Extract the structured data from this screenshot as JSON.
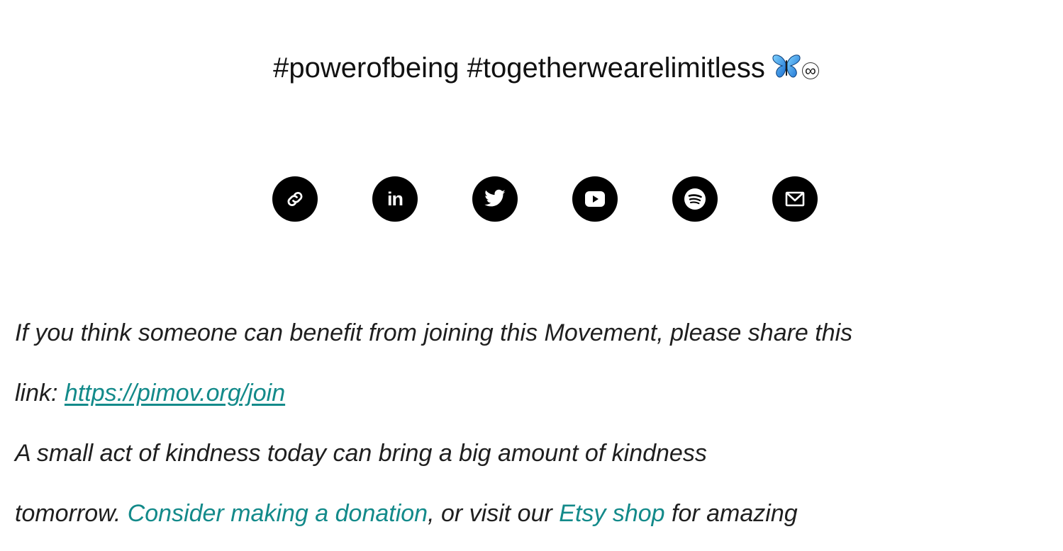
{
  "hashtags": {
    "text": "#powerofbeing #togetherwearelimitless",
    "emoji_icon": "butterfly-icon",
    "infinity_symbol": "∞"
  },
  "social_links": [
    {
      "name": "link",
      "icon": "link-icon"
    },
    {
      "name": "linkedin",
      "icon": "linkedin-icon",
      "text": "in"
    },
    {
      "name": "twitter",
      "icon": "twitter-icon"
    },
    {
      "name": "youtube",
      "icon": "youtube-icon"
    },
    {
      "name": "spotify",
      "icon": "spotify-icon"
    },
    {
      "name": "email",
      "icon": "email-icon"
    }
  ],
  "share_paragraph": {
    "line1": "If you think someone can benefit from joining this Movement, please share this",
    "line2_prefix": "link: ",
    "join_link": "https://pimov.org/join"
  },
  "kindness_paragraph": {
    "line1": "A small act of kindness today can bring a big amount of kindness",
    "line2_prefix": "tomorrow. ",
    "donation_link": "Consider making a donation",
    "middle": ", or visit our ",
    "etsy_link": "Etsy shop",
    "suffix": " for amazing"
  },
  "colors": {
    "link": "#138a8a",
    "icon_background": "#000000",
    "butterfly": "#3aa7e6"
  }
}
